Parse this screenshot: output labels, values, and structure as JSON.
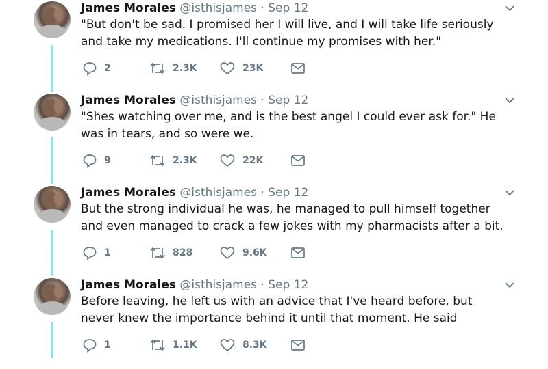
{
  "tweets": [
    {
      "name": "James Morales",
      "handle": "@isthisjames",
      "separator": "·",
      "date": "Sep 12",
      "text": "\"But don't be sad. I promised her I will live, and I will take life seriously and take my medications. I'll continue my promises with her.\"",
      "replies": "2",
      "retweets": "2.3K",
      "likes": "23K"
    },
    {
      "name": "James Morales",
      "handle": "@isthisjames",
      "separator": "·",
      "date": "Sep 12",
      "text": "\"Shes watching over me, and is the best angel I could ever ask for.\" He was in tears, and so were we.",
      "replies": "9",
      "retweets": "2.3K",
      "likes": "22K"
    },
    {
      "name": "James Morales",
      "handle": "@isthisjames",
      "separator": "·",
      "date": "Sep 12",
      "text": "But the strong individual he was, he managed to pull himself together and even managed to crack a few jokes with my pharmacists after a bit.",
      "replies": "1",
      "retweets": "828",
      "likes": "9.6K"
    },
    {
      "name": "James Morales",
      "handle": "@isthisjames",
      "separator": "·",
      "date": "Sep 12",
      "text": "Before leaving, he left us with an advice that I've heard before, but never knew the importance behind it until that moment. He said",
      "replies": "1",
      "retweets": "1.1K",
      "likes": "8.3K"
    }
  ],
  "icons": {
    "reply": "reply-icon",
    "retweet": "retweet-icon",
    "like": "heart-icon",
    "dm": "envelope-icon",
    "caret": "chevron-down-icon"
  },
  "colors": {
    "thread_line": "#8ee0f2",
    "secondary_text": "#657786",
    "primary_text": "#14171a"
  }
}
